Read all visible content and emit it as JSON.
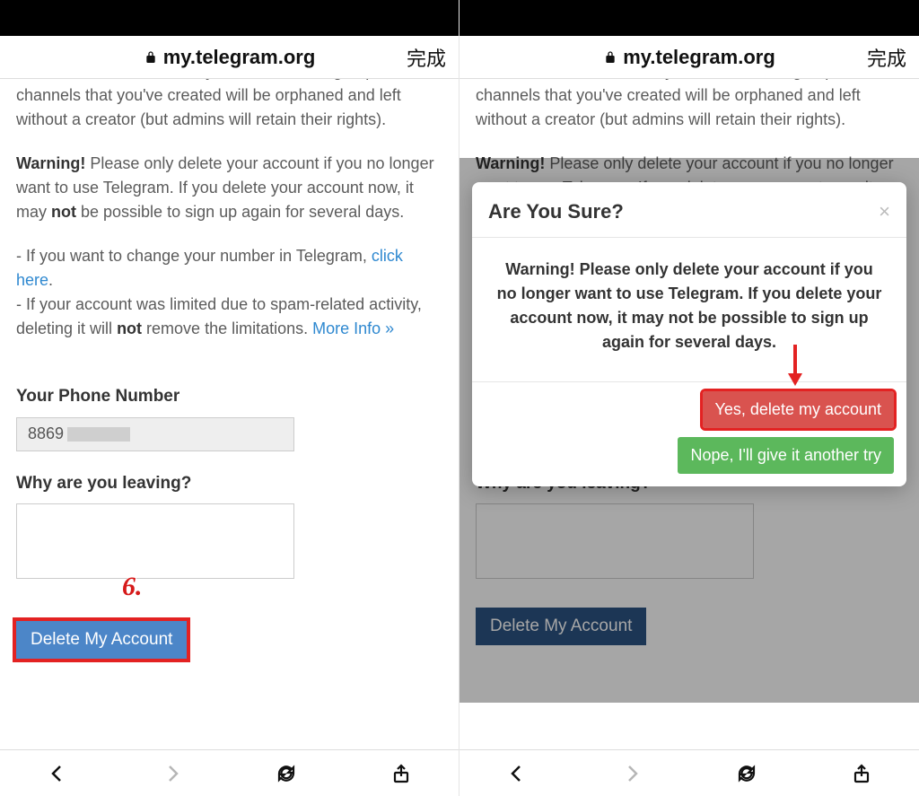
{
  "browser": {
    "domain": "my.telegram.org",
    "done_label": "完成"
  },
  "page": {
    "cutoff_line": "contacts will be deleted beyond retrieval. All",
    "orphan_text": "groups and channels that you've created will be orphaned and left without a creator (but admins will retain their rights).",
    "warn_label": "Warning!",
    "warn_text_1": " Please only delete your account if you no longer want to use Telegram. If you delete your account now, it may ",
    "warn_not": "not",
    "warn_text_2": " be possible to sign up again for several days.",
    "bullet1_pre": "- If you want to change your number in Telegram, ",
    "bullet1_link": "click here",
    "bullet1_post": ".",
    "bullet2_pre": "- If your account was limited due to spam-related activity, deleting it will ",
    "bullet2_not": "not",
    "bullet2_post": " remove the limitations. ",
    "bullet2_link": "More Info »"
  },
  "form": {
    "phone_label": "Your Phone Number",
    "phone_prefix": "8869",
    "reason_label": "Why are you leaving?",
    "submit_label": "Delete My Account"
  },
  "step": {
    "label": "6."
  },
  "modal": {
    "title": "Are You Sure?",
    "body": "Warning! Please only delete your account if you no longer want to use Telegram. If you delete your account now, it may not be possible to sign up again for several days.",
    "confirm": "Yes, delete my account",
    "cancel": "Nope, I'll give it another try"
  }
}
